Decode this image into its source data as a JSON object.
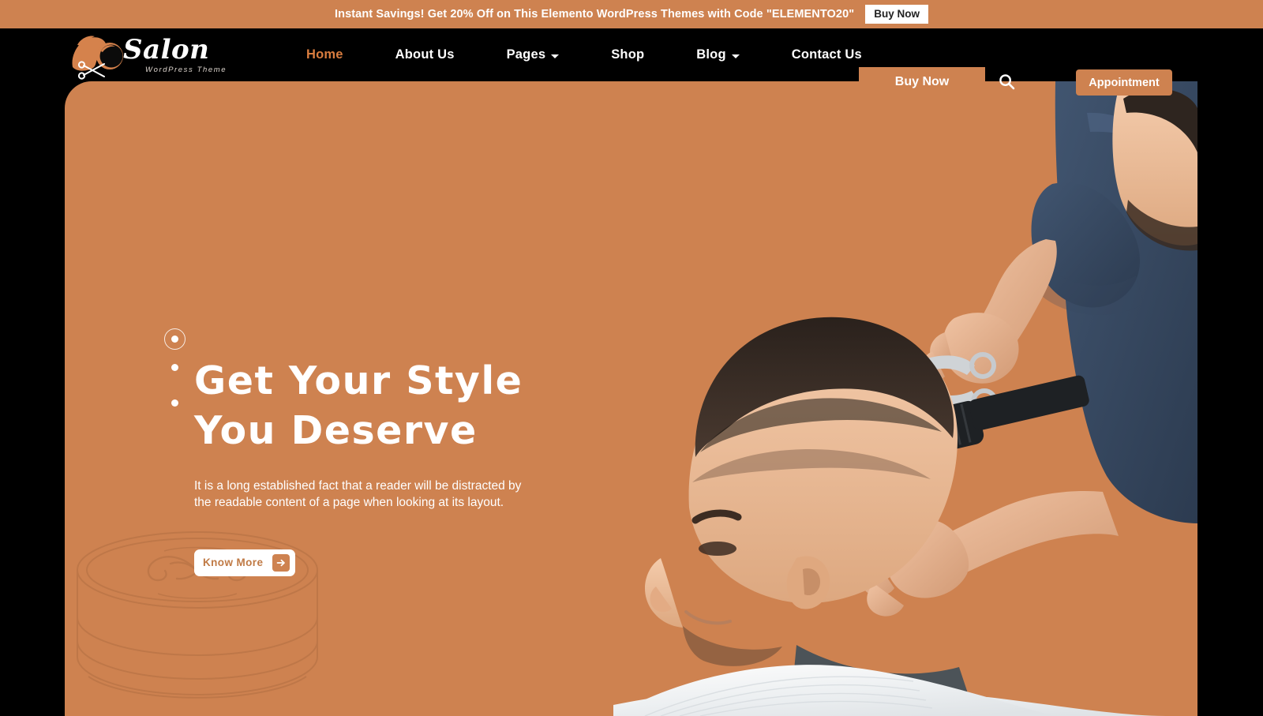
{
  "promo": {
    "text": "Instant Savings! Get 20% Off on This Elemento WordPress Themes with Code \"ELEMENTO20\"",
    "button_label": "Buy Now"
  },
  "header": {
    "logo": {
      "name": "Salon",
      "subtitle": "WordPress Theme"
    },
    "nav": [
      {
        "label": "Home",
        "active": true,
        "dropdown": false
      },
      {
        "label": "About Us",
        "active": false,
        "dropdown": false
      },
      {
        "label": "Pages",
        "active": false,
        "dropdown": true
      },
      {
        "label": "Shop",
        "active": false,
        "dropdown": false
      },
      {
        "label": "Blog",
        "active": false,
        "dropdown": true
      },
      {
        "label": "Contact Us",
        "active": false,
        "dropdown": false
      }
    ],
    "buy_now_label": "Buy Now",
    "search_icon": "search-icon",
    "appointment_label": "Appointment"
  },
  "hero": {
    "title_line_1": "Get Your Style",
    "title_line_2": "You Deserve",
    "description": "It is a long established fact that a reader will be distracted by the readable content of a page when looking at its layout.",
    "cta_label": "Know More",
    "cta_icon": "arrow-right-icon",
    "slider_dots": 3,
    "active_dot": 1,
    "image_alt": "barber cutting client hair with comb and scissors",
    "watermark_alt": "vintage pomade tin with mustache illustration"
  },
  "colors": {
    "accent": "#ce8250",
    "header_bg": "#000000",
    "page_bg": "#000000",
    "hero_bg": "#ce8250",
    "nav_active": "#d97d3f",
    "text_light": "#ffffff"
  }
}
